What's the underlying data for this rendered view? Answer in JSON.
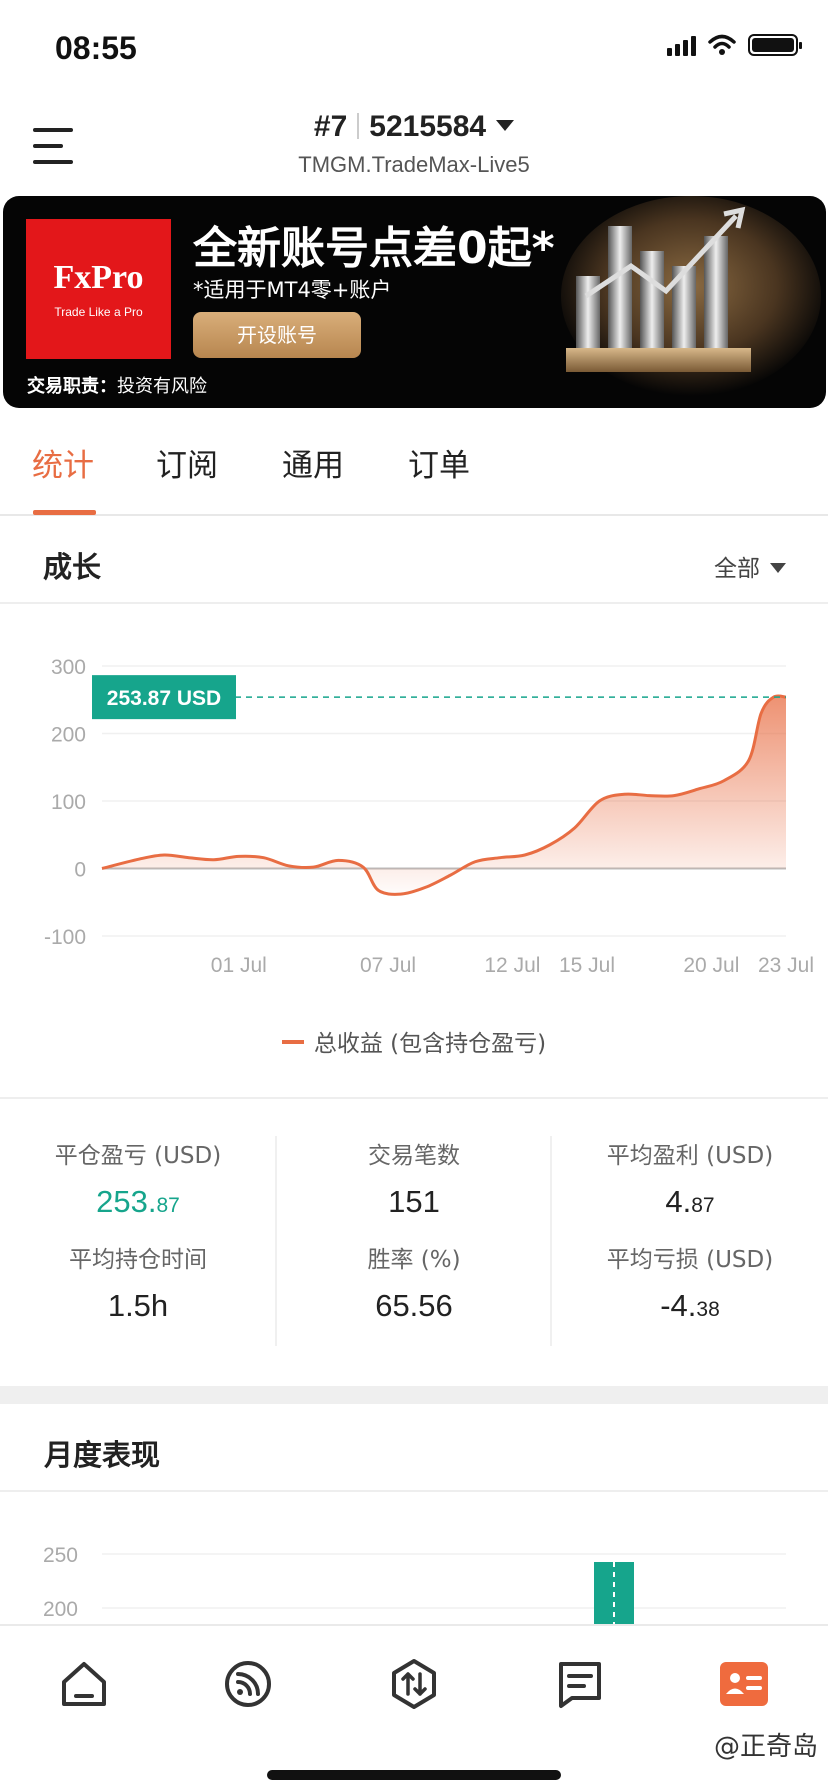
{
  "status_bar": {
    "time": "08:55"
  },
  "header": {
    "account_prefix": "#7",
    "account_number": "5215584",
    "server": "TMGM.TradeMax-Live5"
  },
  "banner": {
    "brand": "FxPro",
    "brand_tagline": "Trade Like a Pro",
    "headline": "全新账号点差0起*",
    "subtext": "*适用于MT4零+账户",
    "cta": "开设账号",
    "disclaimer_label": "交易职责：",
    "disclaimer_text": "投资有风险"
  },
  "tabs": [
    "统计",
    "订阅",
    "通用",
    "订单"
  ],
  "active_tab": "统计",
  "growth": {
    "title": "成长",
    "range": "全部",
    "current_label": "253.87 USD",
    "legend": "总收益 (包含持仓盈亏)"
  },
  "chart_data": [
    {
      "type": "area",
      "title": "成长",
      "ylim": [
        -100,
        300
      ],
      "yticks": [
        "300",
        "200",
        "100",
        "0",
        "-100"
      ],
      "xtick_labels": [
        "01 Jul",
        "07 Jul",
        "12 Jul",
        "15 Jul",
        "20 Jul",
        "23 Jul"
      ],
      "series": [
        {
          "name": "总收益 (包含持仓盈亏)",
          "color": "#e86d43",
          "points": [
            [
              -4.5,
              0
            ],
            [
              -3,
              14
            ],
            [
              -2,
              20
            ],
            [
              -1,
              16
            ],
            [
              0,
              13
            ],
            [
              1,
              18
            ],
            [
              2,
              16
            ],
            [
              3,
              4
            ],
            [
              4,
              2
            ],
            [
              5,
              12
            ],
            [
              6,
              2
            ],
            [
              6.6,
              -32
            ],
            [
              7.5,
              -38
            ],
            [
              8.5,
              -28
            ],
            [
              9.5,
              -10
            ],
            [
              10.5,
              10
            ],
            [
              11.5,
              16
            ],
            [
              12.5,
              20
            ],
            [
              13.5,
              35
            ],
            [
              14.5,
              60
            ],
            [
              15.5,
              100
            ],
            [
              16.5,
              110
            ],
            [
              17.5,
              108
            ],
            [
              18.5,
              108
            ],
            [
              19.5,
              118
            ],
            [
              20.5,
              130
            ],
            [
              21.5,
              160
            ],
            [
              22,
              230
            ],
            [
              22.5,
              253.87
            ],
            [
              23,
              253.87
            ]
          ]
        }
      ],
      "annotation": "253.87 USD",
      "grid": true
    },
    {
      "type": "bar",
      "title": "月度表现",
      "yticks": [
        "250",
        "200"
      ],
      "values_visible": [
        {
          "color": "#16a58c"
        }
      ]
    }
  ],
  "stats": [
    {
      "label": "平仓盈亏 (USD)",
      "value_main": "253.",
      "value_small": "87",
      "color": "green"
    },
    {
      "label": "交易笔数",
      "value_main": "151",
      "value_small": ""
    },
    {
      "label": "平均盈利 (USD)",
      "value_main": "4.",
      "value_small": "87"
    },
    {
      "label": "平均持仓时间",
      "value_main": "1.5h",
      "value_small": ""
    },
    {
      "label": "胜率 (%)",
      "value_main": "65.56",
      "value_small": ""
    },
    {
      "label": "平均亏损 (USD)",
      "value_main": "-4.",
      "value_small": "38"
    }
  ],
  "monthly": {
    "title": "月度表现"
  },
  "nav": [
    "home-icon",
    "feed-icon",
    "trade-icon",
    "notes-icon",
    "account-card-icon"
  ],
  "watermark": "@正奇岛"
}
